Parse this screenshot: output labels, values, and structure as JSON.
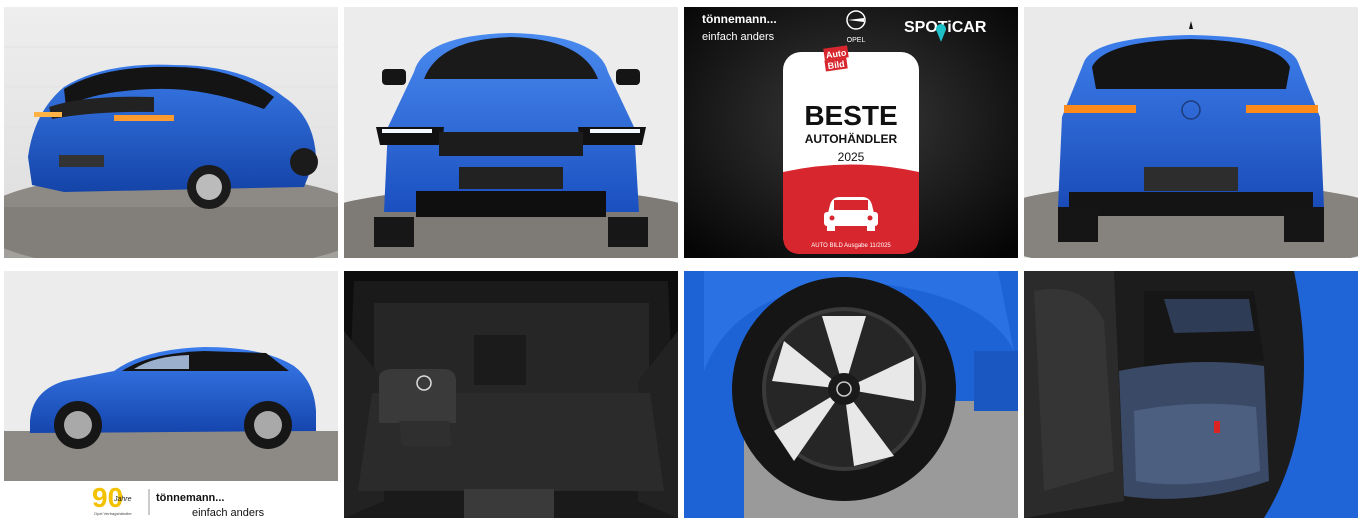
{
  "gallery": {
    "images": [
      {
        "view": "rear-three-quarter"
      },
      {
        "view": "front"
      },
      {
        "view": "dealer-award"
      },
      {
        "view": "rear"
      },
      {
        "view": "side-profile"
      },
      {
        "view": "trunk"
      },
      {
        "view": "wheel"
      },
      {
        "view": "rear-seats"
      }
    ]
  },
  "award": {
    "dealer_name": "tönnemann...",
    "dealer_slogan": "einfach anders",
    "brand": "OPEL",
    "spoticar": "SPOTiCAR",
    "magazine_top": "Auto",
    "magazine_bottom": "Bild",
    "title": "BESTE",
    "subtitle": "AUTOHÄNDLER",
    "year": "2025",
    "footnote": "AUTO BILD Ausgabe 11/2025"
  },
  "dealer_logo": {
    "anniversary_number": "90",
    "anniversary_word": "Jahre",
    "partner_text": "Opel Vertragshändler",
    "name": "tönnemann...",
    "slogan": "einfach anders"
  },
  "colors": {
    "car_blue": "#1f5fd0",
    "award_red": "#d8262e",
    "spoticar_teal": "#1fc1c8",
    "logo_yellow": "#f2c200"
  }
}
